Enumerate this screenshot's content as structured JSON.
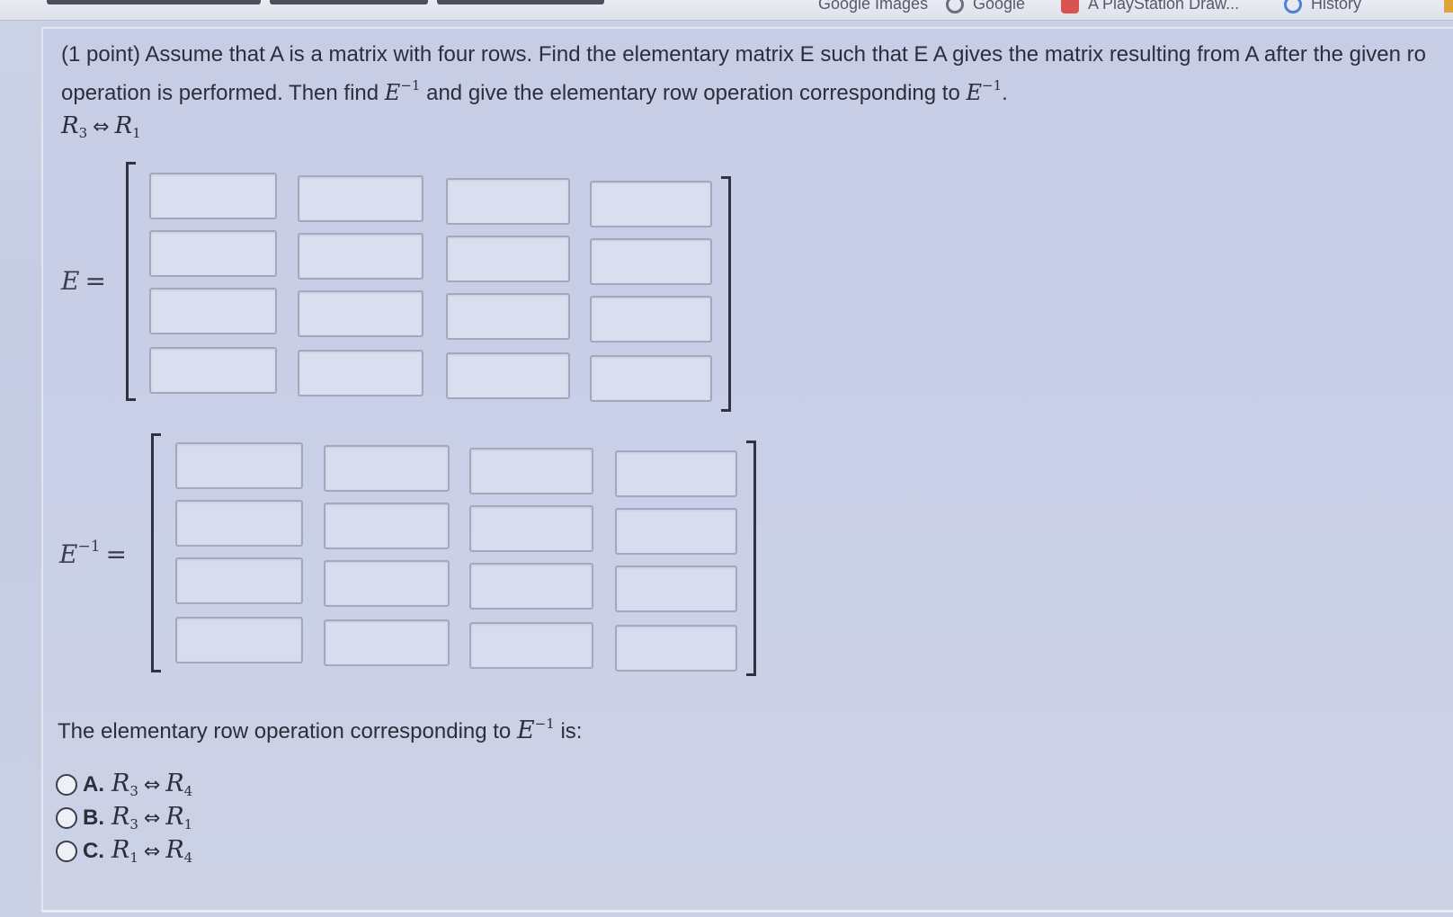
{
  "browser": {
    "bookmarks": [
      {
        "label": "Google Images",
        "icon": "google-icon"
      },
      {
        "label": "Google",
        "icon": "google-icon"
      },
      {
        "label": "A PlayStation Draw...",
        "icon": "bookmark-icon"
      },
      {
        "label": "History",
        "icon": "history-icon"
      }
    ]
  },
  "problem": {
    "line1": "(1 point) Assume that A is a matrix with four rows. Find the elementary matrix E such that E A gives the matrix resulting from A after the given ro",
    "line2_a": "operation is performed. Then find",
    "line2_b": "and give the elementary row operation corresponding to",
    "E": "E",
    "inv_sup": "−1",
    "period": ".",
    "op": {
      "left": "R",
      "left_sub": "3",
      "arrow": "⇔",
      "right": "R",
      "right_sub": "1"
    }
  },
  "matrix_E": {
    "label": "E",
    "eq": "=",
    "cells": [
      [
        "",
        "",
        "",
        ""
      ],
      [
        "",
        "",
        "",
        ""
      ],
      [
        "",
        "",
        "",
        ""
      ],
      [
        "",
        "",
        "",
        ""
      ]
    ]
  },
  "matrix_Einv": {
    "label": "E",
    "sup": "−1",
    "eq": "=",
    "cells": [
      [
        "",
        "",
        "",
        ""
      ],
      [
        "",
        "",
        "",
        ""
      ],
      [
        "",
        "",
        "",
        ""
      ],
      [
        "",
        "",
        "",
        ""
      ]
    ]
  },
  "question": {
    "text_a": "The elementary row operation corresponding to",
    "E": "E",
    "sup": "−1",
    "text_b": "is:"
  },
  "choices": [
    {
      "letter": "A.",
      "left": "R",
      "left_sub": "3",
      "arrow": "⇔",
      "right": "R",
      "right_sub": "4"
    },
    {
      "letter": "B.",
      "left": "R",
      "left_sub": "3",
      "arrow": "⇔",
      "right": "R",
      "right_sub": "1"
    },
    {
      "letter": "C.",
      "left": "R",
      "left_sub": "1",
      "arrow": "⇔",
      "right": "R",
      "right_sub": "4"
    }
  ]
}
